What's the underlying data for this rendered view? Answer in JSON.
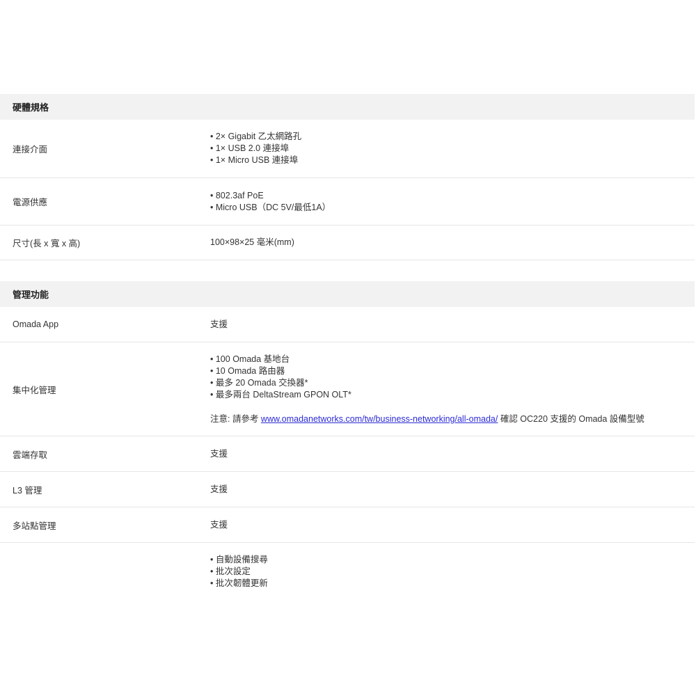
{
  "sections": [
    {
      "title": "硬體規格",
      "rows": [
        {
          "label": "連接介面",
          "items": [
            "2× Gigabit 乙太網路孔",
            "1× USB 2.0 連接埠",
            "1× Micro USB 連接埠"
          ]
        },
        {
          "label": "電源供應",
          "items": [
            "802.3af PoE",
            "Micro USB（DC 5V/最低1A）"
          ]
        },
        {
          "label": "尺寸(長 x 寬 x 高)",
          "value": "100×98×25 毫米(mm)"
        }
      ]
    },
    {
      "title": "管理功能",
      "rows": [
        {
          "label": "Omada App",
          "value": "支援"
        },
        {
          "label": "集中化管理",
          "items": [
            "100 Omada 基地台",
            "10 Omada 路由器",
            "最多 20 Omada 交換器*",
            "最多兩台 DeltaStream GPON OLT*"
          ],
          "note_prefix": "注意: 請參考 ",
          "note_link": "www.omadanetworks.com/tw/business-networking/all-omada/",
          "note_suffix": " 確認 OC220 支援的 Omada 設備型號"
        },
        {
          "label": "雲端存取",
          "value": "支援"
        },
        {
          "label": "L3 管理",
          "value": "支援"
        },
        {
          "label": "多站點管理",
          "value": "支援"
        },
        {
          "label": "",
          "items": [
            "自動設備搜尋",
            "批次設定",
            "批次韌體更新"
          ]
        }
      ]
    }
  ]
}
